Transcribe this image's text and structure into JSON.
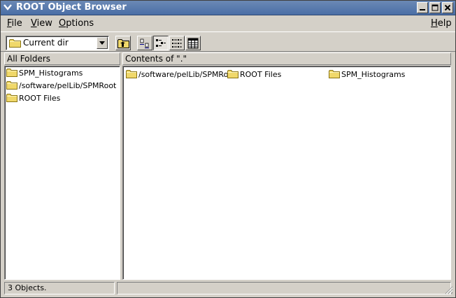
{
  "window": {
    "title": "ROOT Object Browser"
  },
  "menu": {
    "file": {
      "accel": "F",
      "rest": "ile"
    },
    "view": {
      "accel": "V",
      "rest": "iew"
    },
    "options": {
      "accel": "O",
      "rest": "ptions"
    },
    "help": {
      "accel": "H",
      "rest": "elp"
    }
  },
  "toolbar": {
    "location": "Current dir",
    "icons": [
      "folder-up-icon",
      "large-icons-view-icon",
      "small-icons-view-icon",
      "list-view-icon",
      "details-view-icon"
    ]
  },
  "left_panel": {
    "header": "All Folders",
    "items": [
      {
        "label": "SPM_Histograms",
        "icon": "folder-icon"
      },
      {
        "label": "/software/pelLib/SPMRoot",
        "icon": "folder-icon"
      },
      {
        "label": "ROOT Files",
        "icon": "folder-icon"
      }
    ]
  },
  "right_panel": {
    "header": "Contents of \".\"",
    "items": [
      {
        "label": "/software/pelLib/SPMRoot",
        "icon": "folder-icon"
      },
      {
        "label": "ROOT Files",
        "icon": "folder-icon"
      },
      {
        "label": "SPM_Histograms",
        "icon": "folder-icon"
      }
    ]
  },
  "status": {
    "count": "3 Objects.",
    "secondary": ""
  },
  "colors": {
    "titlebar": "#4a6ea6",
    "chrome": "#d4d0c8",
    "folder": "#f0d86a",
    "folder_edge": "#8a7412"
  }
}
